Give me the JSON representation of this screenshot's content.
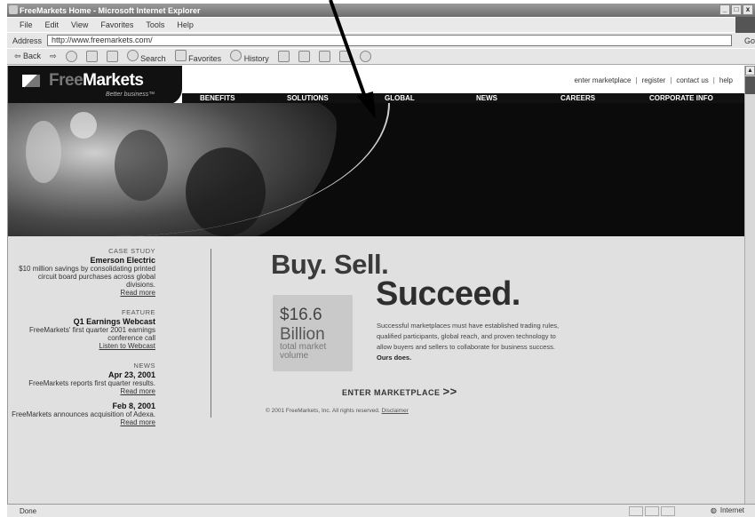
{
  "window": {
    "title": "FreeMarkets Home - Microsoft Internet Explorer",
    "controls": [
      "_",
      "□",
      "x"
    ]
  },
  "menu": [
    "File",
    "Edit",
    "View",
    "Favorites",
    "Tools",
    "Help"
  ],
  "address": {
    "label": "Address",
    "url": "http://www.freemarkets.com/",
    "go_label": "Go"
  },
  "toolbar": {
    "back": "Back",
    "search": "Search",
    "favorites": "Favorites",
    "history": "History"
  },
  "site": {
    "logo_free": "Free",
    "logo_markets": "Markets",
    "tagline": "Better business™",
    "utility": [
      "enter marketplace",
      "register",
      "contact us",
      "help"
    ],
    "nav": [
      "BENEFITS",
      "SOLUTIONS",
      "GLOBAL",
      "NEWS",
      "CAREERS",
      "CORPORATE INFO"
    ]
  },
  "sidebar": {
    "case_head": "CASE STUDY",
    "case_title": "Emerson Electric",
    "case_text": "$10 million savings by consolidating printed circuit board purchases across global divisions.",
    "case_link": "Read more",
    "feature_head": "FEATURE",
    "feature_title": "Q1 Earnings Webcast",
    "feature_text": "FreeMarkets' first quarter 2001 earnings conference call",
    "feature_link": "Listen to Webcast",
    "news_head": "NEWS",
    "news1_date": "Apr 23, 2001",
    "news1_text": "FreeMarkets reports first quarter results.",
    "news1_link": "Read more",
    "news2_date": "Feb 8, 2001",
    "news2_text": "FreeMarkets announces acquisition of Adexa.",
    "news2_link": "Read more"
  },
  "main": {
    "headline1": "Buy. Sell.",
    "headline2": "Succeed.",
    "stat_amount": "$16.6",
    "stat_unit": "Billion",
    "stat_desc": "total market volume",
    "blurb": "Successful marketplaces must have established trading rules, qualified participants, global reach, and proven technology to allow buyers and sellers to collaborate for business success.",
    "blurb_bold": "Ours does.",
    "enter": "ENTER MARKETPLACE",
    "enter_arrows": ">>",
    "copyright": "© 2001 FreeMarkets, Inc. All rights reserved.",
    "copyright_link": "Disclaimer"
  },
  "status": {
    "left": "Done",
    "zone": "Internet"
  }
}
